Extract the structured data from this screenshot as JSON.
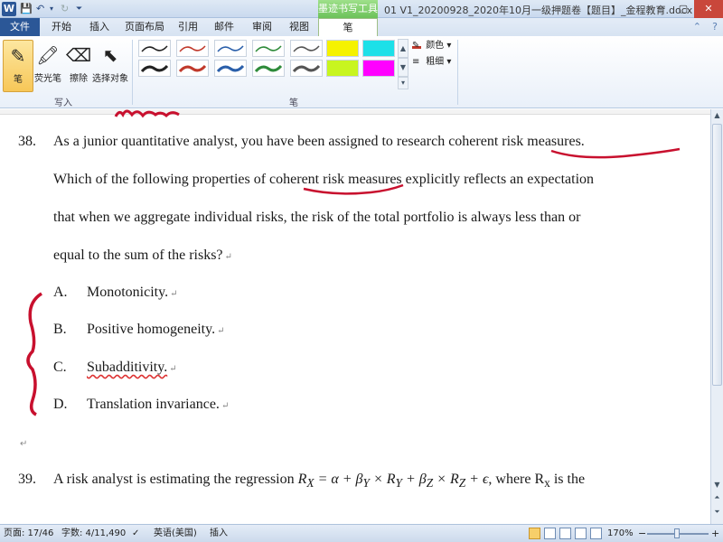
{
  "titlebar": {
    "logo": "W",
    "save_icon": "💾",
    "undo_icon": "↶",
    "undo_dropdown": "▾",
    "redo_icon": "↻",
    "customize": "⏷",
    "context_group": "墨迹书写工具",
    "doc_title": "01 V1_20200928_2020年10月一级押题卷【题目】_金程教育.docx",
    "min": "─",
    "max": "▢",
    "close": "✕"
  },
  "tabs": {
    "file": "文件",
    "home": "开始",
    "insert": "插入",
    "layout": "页面布局",
    "refs": "引用",
    "mail": "邮件",
    "review": "审阅",
    "view": "视图",
    "pen": "笔",
    "minimize_icon": "⌃",
    "help_icon": "?"
  },
  "ribbon": {
    "tools": [
      {
        "label": "笔",
        "icon": "✎"
      },
      {
        "label": "荧光笔",
        "icon": "🖍"
      },
      {
        "label": "擦除",
        "icon": "⌫"
      },
      {
        "label": "选择对象",
        "icon": "⬉"
      }
    ],
    "group_write": "写入",
    "group_pen": "笔",
    "pen_colors": [
      "#222222",
      "#c0392b",
      "#2a5faa",
      "#2e8b3a",
      "#555555",
      "#222222",
      "#c0392b",
      "#2a5faa",
      "#2e8b3a",
      "#555555"
    ],
    "fill_colors": [
      "#f5f200",
      "#1de0e8",
      "#ff00ff",
      "#c8f51f"
    ],
    "color_label": "颜色",
    "thickness_label": "粗细",
    "gallery_up": "▲",
    "gallery_down": "▼",
    "gallery_more": "▾"
  },
  "doc": {
    "q38_num": "38.",
    "q38_lines": [
      "As a junior quantitative analyst, you have been assigned to research coherent risk measures.",
      "Which of the following properties of coherent risk measures explicitly reflects an expectation",
      "that when we aggregate individual risks, the risk of the total portfolio is always less than or",
      "equal to the sum of the risks?"
    ],
    "options": [
      {
        "letter": "A.",
        "text": "Monotonicity."
      },
      {
        "letter": "B.",
        "text": "Positive homogeneity."
      },
      {
        "letter": "C.",
        "text": "Subadditivity."
      },
      {
        "letter": "D.",
        "text": "Translation invariance."
      }
    ],
    "para_mark": "↵",
    "q39_num": "39.",
    "q39_prefix": "A risk analyst is estimating the regression ",
    "q39_formula": "R",
    "q39_suffix": ", where R",
    "q39_tail": " is the"
  },
  "status": {
    "page": "页面: 17/46",
    "words": "字数: 4/11,490",
    "lang": "英语(美国)",
    "ins": "插入",
    "zoom": "170%",
    "zoom_minus": "−",
    "zoom_plus": "+"
  }
}
